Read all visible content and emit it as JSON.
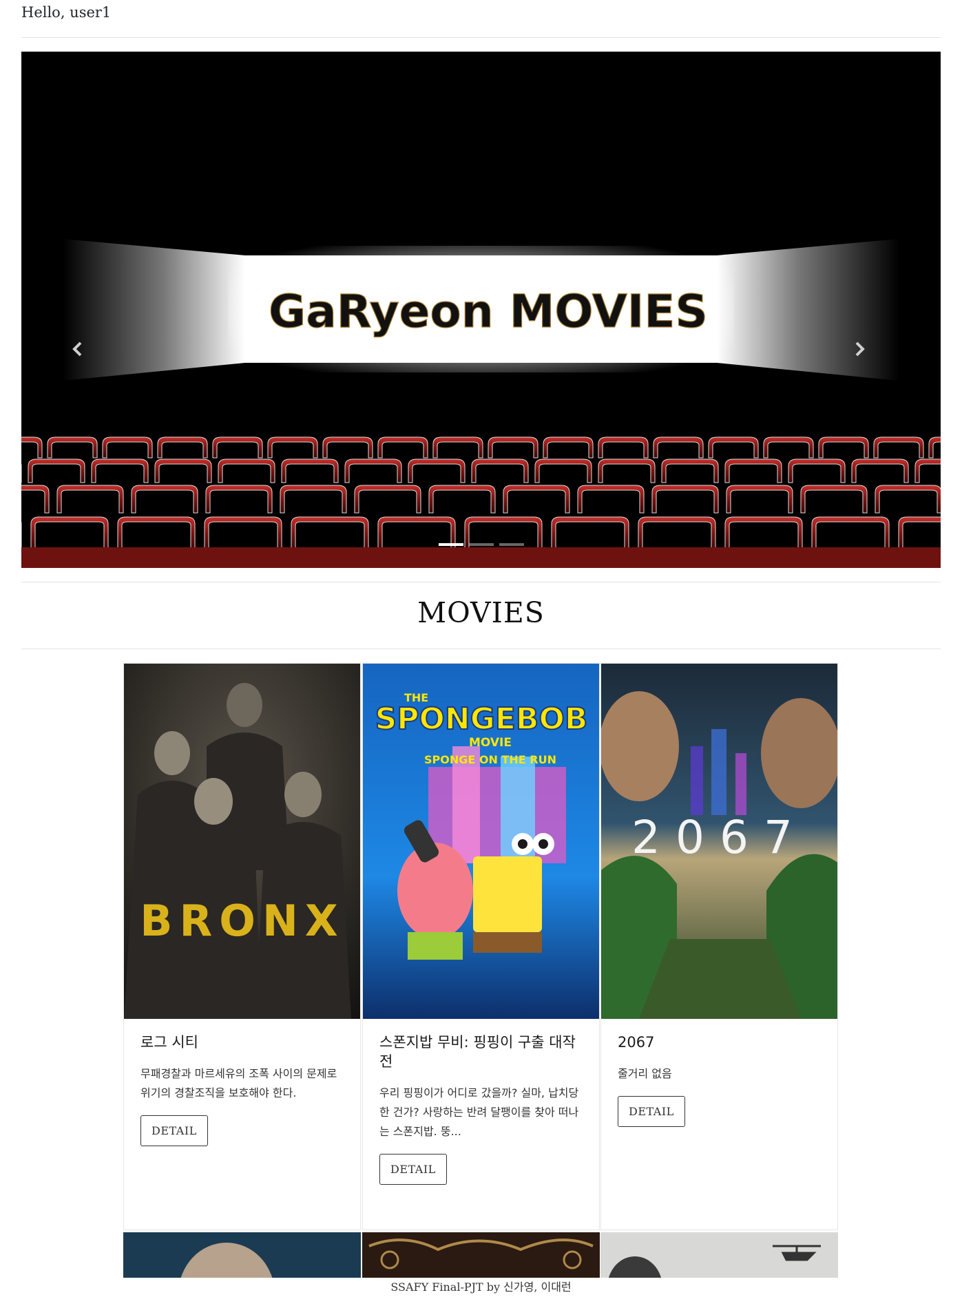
{
  "header": {
    "greeting": "Hello, user1"
  },
  "carousel": {
    "banner_text": "GaRyeon MOVIES",
    "prev_icon": "chevron-left-icon",
    "next_icon": "chevron-right-icon",
    "slide_count": 3,
    "active_slide": 1
  },
  "section": {
    "title": "MOVIES"
  },
  "movies": [
    {
      "poster_text": "BRONX",
      "title": "로그 시티",
      "description": "무패경찰과 마르세유의 조폭 사이의 문제로 위기의 경찰조직을 보호해야 한다.",
      "button": "DETAIL"
    },
    {
      "poster_text": "SPONGEBOB",
      "poster_subtext": "THE",
      "poster_movie": "MOVIE",
      "poster_tagline": "SPONGE ON THE RUN",
      "title": "스폰지밥 무비: 핑핑이 구출 대작전",
      "description": "우리 핑핑이가 어디로 갔을까? 실마, 납치당한 건가? 사랑하는 반려 달팽이를 찾아 떠나는 스폰지밥. 뚱...",
      "button": "DETAIL"
    },
    {
      "poster_text": "2067",
      "title": "2067",
      "description": "줄거리 없음",
      "button": "DETAIL"
    }
  ],
  "footer": {
    "text": "SSAFY Final-PJT by 신가영, 이대런"
  },
  "colors": {
    "curtain_red": "#6e1210",
    "seat_red": "#8a1512",
    "banner_bg": "#ffffff"
  }
}
